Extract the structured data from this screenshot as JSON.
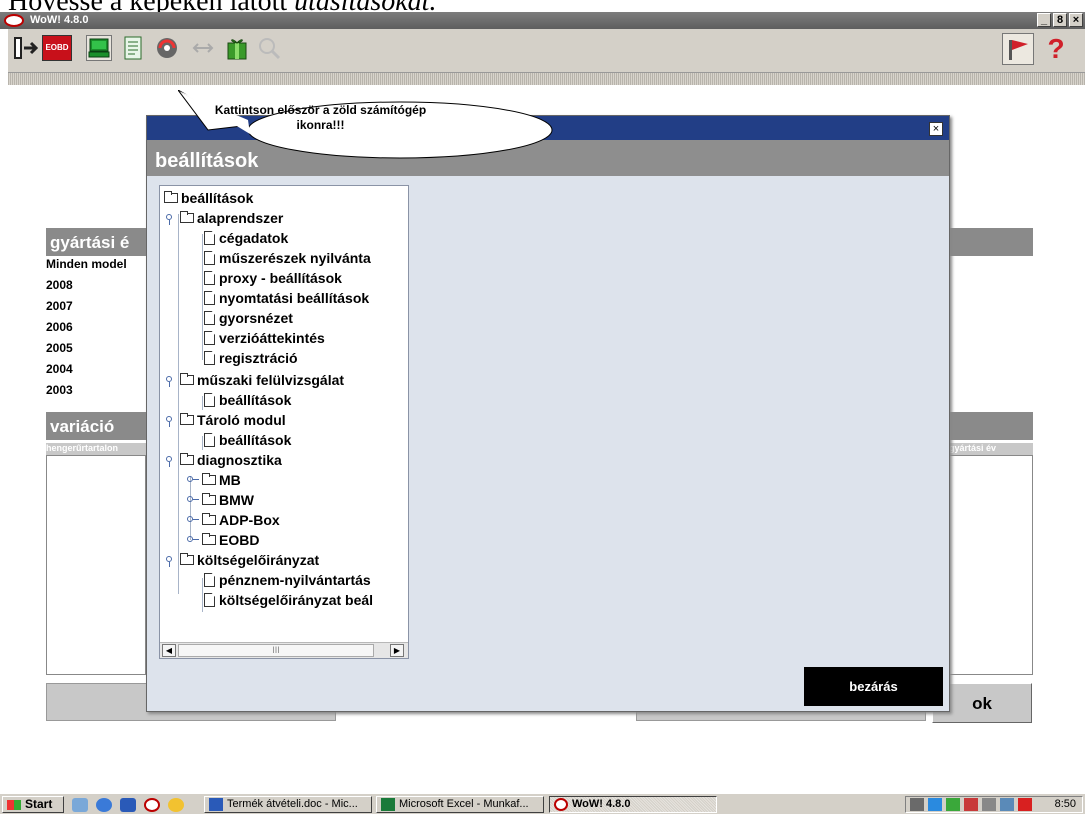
{
  "document_heading": {
    "normal": "Hövesse a képeken látott ",
    "italic": "utasításokat."
  },
  "window": {
    "title": "WoW! 4.8.0",
    "controls": [
      "_",
      "8",
      "×"
    ]
  },
  "toolbar": {
    "buttons": [
      {
        "name": "exit",
        "icon": "exit-door-icon"
      },
      {
        "name": "eobd",
        "label": "EOBD",
        "icon": "eobd-icon"
      },
      {
        "name": "settings-computer",
        "icon": "green-computer-icon"
      },
      {
        "name": "notes",
        "icon": "notepad-icon"
      },
      {
        "name": "update",
        "icon": "update-icon"
      },
      {
        "name": "back",
        "icon": "arrows-icon"
      },
      {
        "name": "gift",
        "icon": "gift-icon"
      },
      {
        "name": "search",
        "icon": "search-icon"
      }
    ],
    "right_buttons": [
      {
        "name": "flag",
        "icon": "flag-icon"
      },
      {
        "name": "help",
        "label": "?",
        "icon": "help-icon"
      }
    ]
  },
  "callout": {
    "text_line1": "Kattintson először a zöld számítógép",
    "text_line2": "ikonra!!!"
  },
  "background": {
    "year_header": "gyártási é",
    "years": [
      "Minden model",
      "2008",
      "2007",
      "2006",
      "2005",
      "2004",
      "2003"
    ],
    "variation_header": "variáció",
    "variation_col_left": "hengerűrtartalon",
    "variation_col_right": "gyártási év",
    "ok_label": "ok"
  },
  "dialog": {
    "close_x": "×",
    "heading": "beállítások",
    "close_button": "bezárás",
    "tree": {
      "root": "beállítások",
      "groups": [
        {
          "label": "alaprendszer",
          "children": [
            "cégadatok",
            "műszerészek nyilvánta",
            "proxy - beállítások",
            "nyomtatási beállítások",
            "gyorsnézet",
            "verzióáttekintés",
            "regisztráció"
          ]
        },
        {
          "label": "műszaki felülvizsgálat",
          "children": [
            "beállítások"
          ]
        },
        {
          "label": "Tároló modul",
          "children": [
            "beállítások"
          ]
        },
        {
          "label": "diagnosztika",
          "folders": [
            "MB",
            "BMW",
            "ADP-Box",
            "EOBD"
          ]
        },
        {
          "label": "költségelőirányzat",
          "children": [
            "pénznem-nyilvántartás",
            "költségelőirányzat beál"
          ]
        }
      ],
      "scroll_thumb": "III"
    }
  },
  "taskbar": {
    "start": "Start",
    "tasks": [
      "Termék átvételi.doc - Mic...",
      "Microsoft Excel - Munkaf...",
      "WoW! 4.8.0"
    ],
    "clock": "8:50"
  },
  "colors": {
    "dialog_title": "#223e86",
    "dialog_heading": "#8e8e8e",
    "close_button": "#000000",
    "toolbar": "#d4d0c8"
  }
}
